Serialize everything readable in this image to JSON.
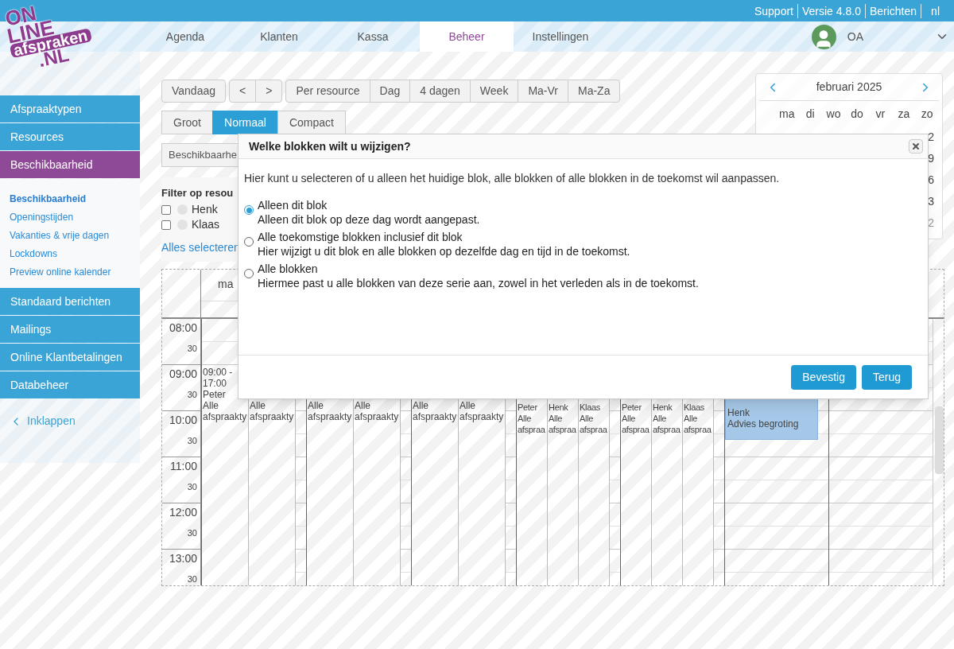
{
  "logo": {
    "lines": [
      "ON",
      "LINE",
      "afspraken",
      ".NL"
    ]
  },
  "top_links": [
    "Support",
    "Versie 4.8.0",
    "Berichten",
    "nl"
  ],
  "nav": {
    "tabs": [
      {
        "label": "Agenda",
        "selected": false
      },
      {
        "label": "Klanten",
        "selected": false
      },
      {
        "label": "Kassa",
        "selected": false
      },
      {
        "label": "Beheer",
        "selected": true
      },
      {
        "label": "Instellingen",
        "selected": false
      }
    ],
    "user": "OA"
  },
  "sidebar": {
    "items": [
      {
        "label": "Afspraaktypen",
        "selected": false
      },
      {
        "label": "Resources",
        "selected": false
      },
      {
        "label": "Beschikbaarheid",
        "selected": true,
        "children": [
          {
            "label": "Beschikbaarheid",
            "selected": true
          },
          {
            "label": "Openingstijden",
            "selected": false
          },
          {
            "label": "Vakanties & vrije dagen",
            "selected": false
          },
          {
            "label": "Lockdowns",
            "selected": false
          },
          {
            "label": "Preview online kalender",
            "selected": false
          }
        ]
      },
      {
        "label": "Standaard berichten",
        "selected": false
      },
      {
        "label": "Mailings",
        "selected": false
      },
      {
        "label": "Online Klantbetalingen",
        "selected": false
      },
      {
        "label": "Databeheer",
        "selected": false
      }
    ],
    "collapse": "Inklappen"
  },
  "toolbar": [
    [
      "Vandaag"
    ],
    [
      "<",
      ">"
    ],
    [
      "Per resource",
      "Dag",
      "4 dagen",
      "Week",
      "Ma-Vr",
      "Ma-Za"
    ]
  ],
  "sizes": [
    {
      "label": "Groot",
      "selected": false
    },
    {
      "label": "Normaal",
      "selected": true
    },
    {
      "label": "Compact",
      "selected": false
    }
  ],
  "view_select": {
    "value": "Beschikbaarhe"
  },
  "filter": {
    "title": "Filter op resou",
    "resources": [
      {
        "name": "Henk",
        "checked": false
      },
      {
        "name": "Klaas",
        "checked": false
      }
    ],
    "select_all": "Alles selecteren"
  },
  "mini_calendar": {
    "month": "februari 2025",
    "weekdays": [
      "ma",
      "di",
      "wo",
      "do",
      "vr",
      "za",
      "zo"
    ],
    "sunday_dates": [
      {
        "label": "2",
        "muted": false
      },
      {
        "label": "9",
        "muted": false
      },
      {
        "label": "6",
        "muted": false
      },
      {
        "label": "3",
        "muted": false
      },
      {
        "label": "2",
        "muted": true
      }
    ]
  },
  "calendar": {
    "day_header": "ma",
    "times": [
      {
        "hour": "08:00",
        "half": "30"
      },
      {
        "hour": "09:00",
        "half": "30"
      },
      {
        "hour": "10:00",
        "half": "30"
      },
      {
        "hour": "11:00",
        "half": "30"
      },
      {
        "hour": "12:00",
        "half": "30"
      },
      {
        "hour": "13:00",
        "half": "30"
      }
    ],
    "columns": [
      {
        "kind": "block",
        "day_start": true,
        "lines": [
          "09:00 - 17:00",
          "Peter",
          "Alle",
          "afspraakty"
        ]
      },
      {
        "kind": "block",
        "day_start": false,
        "lines": [
          "Alle",
          "afspraakty"
        ]
      },
      {
        "kind": "spacer",
        "day_start": false
      },
      {
        "kind": "block",
        "day_start": true,
        "lines": [
          "Alle",
          "afspraakty"
        ]
      },
      {
        "kind": "block",
        "day_start": false,
        "lines": [
          "Alle",
          "afspraakty"
        ]
      },
      {
        "kind": "spacer",
        "day_start": false
      },
      {
        "kind": "block",
        "day_start": true,
        "lines": [
          "Alle",
          "afspraakty"
        ]
      },
      {
        "kind": "block",
        "day_start": false,
        "lines": [
          "Alle",
          "afspraakty"
        ]
      },
      {
        "kind": "spacer",
        "day_start": false
      },
      {
        "kind": "narrow",
        "day_start": true,
        "lines": [
          "Peter",
          "Alle",
          "afspraa"
        ]
      },
      {
        "kind": "narrow",
        "day_start": false,
        "lines": [
          "Henk",
          "Alle",
          "afspraa"
        ]
      },
      {
        "kind": "narrow",
        "day_start": false,
        "lines": [
          "Klaas",
          "Alle",
          "afspraa"
        ]
      },
      {
        "kind": "spacer",
        "day_start": false
      },
      {
        "kind": "narrow",
        "day_start": true,
        "lines": [
          "Peter",
          "Alle",
          "afspraa"
        ]
      },
      {
        "kind": "narrow",
        "day_start": false,
        "lines": [
          "Henk",
          "Alle",
          "afspraa"
        ]
      },
      {
        "kind": "narrow",
        "day_start": false,
        "lines": [
          "Klaas",
          "Alle",
          "afspraa"
        ]
      },
      {
        "kind": "spacer",
        "day_start": false
      },
      {
        "kind": "open",
        "day_start": true,
        "appointment": {
          "lines": [
            "Henk",
            "Advies begroting"
          ]
        }
      },
      {
        "kind": "open",
        "day_start": true
      }
    ]
  },
  "dialog": {
    "title": "Welke blokken wilt u wijzigen?",
    "intro": "Hier kunt u selecteren of u alleen het huidige blok, alle blokken of alle blokken in de toekomst wil aanpassen.",
    "options": [
      {
        "title": "Alleen dit blok",
        "description": "Alleen dit blok op deze dag wordt aangepast.",
        "selected": true
      },
      {
        "title": "Alle toekomstige blokken inclusief dit blok",
        "description": "Hier wijzigt u dit blok en alle blokken op dezelfde dag en tijd in de toekomst.",
        "selected": false
      },
      {
        "title": "Alle blokken",
        "description": "Hiermee past u alle blokken van deze serie aan, zowel in het verleden als in de toekomst.",
        "selected": false
      }
    ],
    "buttons": [
      "Bevestig",
      "Terug"
    ]
  }
}
